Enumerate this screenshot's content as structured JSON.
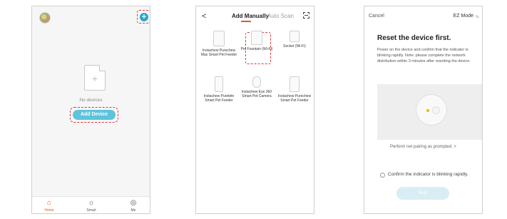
{
  "screen1": {
    "empty_text": "No devices",
    "add_button": "Add Device",
    "plus_glyph": "+",
    "tabs": [
      {
        "label": "Home",
        "icon": "home-icon",
        "glyph": "⌂"
      },
      {
        "label": "Smart",
        "icon": "sun-icon",
        "glyph": "☼"
      },
      {
        "label": "Me",
        "icon": "user-icon",
        "glyph": "◎"
      }
    ],
    "colors": {
      "accent": "#2aa8c9",
      "button": "#5ec3dc",
      "active_tab": "#e8542e",
      "highlight": "#e03a3a"
    }
  },
  "screen2": {
    "tabs": {
      "active": "Add Manually",
      "inactive": "Auto Scan"
    },
    "back_glyph": "<",
    "devices": [
      {
        "name": "Instachew Purechew Max Smart Pet Feeder"
      },
      {
        "name": "Pet Fountain (Wi-Fi)"
      },
      {
        "name": "Socket (Wi-Fi)"
      },
      {
        "name": "Instachew Purebitn Smart Pet Feeder"
      },
      {
        "name": "Instachew Eye 360 Smart Pet Camera"
      },
      {
        "name": "Instachew Purechew Smart Pet Feeder"
      }
    ]
  },
  "screen3": {
    "cancel": "Cancel",
    "mode": "EZ Mode",
    "mode_chevron": "⇆",
    "title": "Reset the device first.",
    "desc": "Power on the device and confirm that the indicator is blinking rapidly. Note: please complete the network distribution within 3 minutes after resetting the device.",
    "pair_link": "Perform net pairing as prompted. >",
    "confirm": "Confirm the indicator is blinking rapidly.",
    "next_button": "Next"
  }
}
